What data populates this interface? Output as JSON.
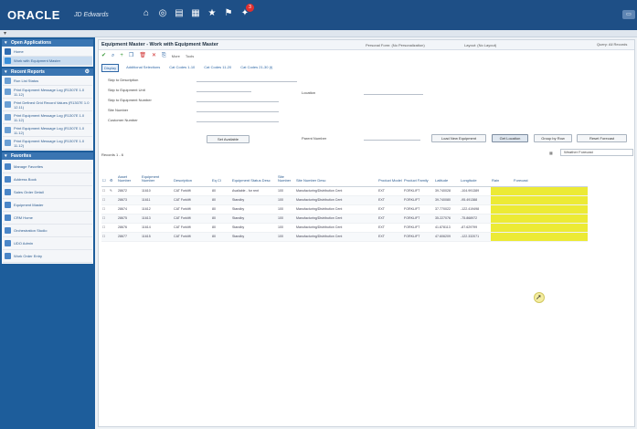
{
  "brand": {
    "logo": "ORACLE",
    "product": "JD Edwards"
  },
  "topbar": {
    "icons": [
      "home-icon",
      "globe-icon",
      "list-icon",
      "document-icon",
      "star-icon",
      "flag-icon",
      "lightbulb-icon"
    ],
    "notification_count": "3",
    "right_button": "▭",
    "colors": {
      "topbar": "#1e4f86",
      "sidebar": "#1d5d9b",
      "highlight": "#ecea35"
    }
  },
  "sidebar": {
    "sections": [
      {
        "title": "Open Applications",
        "items": [
          {
            "label": "Home",
            "icon": "home-icon",
            "color": "#2f6db3"
          },
          {
            "label": "Work with Equipment Master",
            "icon": "app-icon",
            "color": "#3a8fd8",
            "active": true
          }
        ]
      },
      {
        "title": "Recent Reports",
        "items": [
          {
            "label": "Run List Status",
            "icon": "report-icon",
            "color": "#6a9fd4"
          },
          {
            "label": "Print Equipment Message Log (R1307E 1.0 11.12)",
            "icon": "report-icon",
            "color": "#6a9fd4"
          },
          {
            "label": "Print Defined Grid Record Values (R1307E 1.0 12.11)",
            "icon": "report-icon",
            "color": "#6a9fd4"
          },
          {
            "label": "Print Equipment Message Log (R1307E 1.0 11.12)",
            "icon": "report-icon",
            "color": "#6a9fd4"
          },
          {
            "label": "Print Equipment Message Log (R1307E 1.0 11.12)",
            "icon": "report-icon",
            "color": "#6a9fd4"
          },
          {
            "label": "Print Equipment Message Log (R1307E 1.0 11.12)",
            "icon": "report-icon",
            "color": "#6a9fd4"
          }
        ]
      },
      {
        "title": "Favorites",
        "items": [
          {
            "label": "Manage Favorites",
            "icon": "gear-icon",
            "color": "#4a86c8"
          },
          {
            "label": "Address Book",
            "icon": "person-icon",
            "color": "#4a86c8"
          },
          {
            "label": "Sales Order Detail",
            "icon": "cart-icon",
            "color": "#4a86c8"
          },
          {
            "label": "Equipment Master",
            "icon": "person-icon",
            "color": "#4a86c8"
          },
          {
            "label": "CRM Home",
            "icon": "search-icon",
            "color": "#4a86c8"
          },
          {
            "label": "Orchestration Studio",
            "icon": "app-icon",
            "color": "#4a86c8"
          },
          {
            "label": "UDO Admin",
            "icon": "app-icon",
            "color": "#4a86c8"
          },
          {
            "label": "Work Order Entry",
            "icon": "search-icon",
            "color": "#4a86c8"
          }
        ]
      }
    ]
  },
  "main": {
    "title": "Equipment Master - Work with Equipment Master",
    "personal_form_label": "Personal Form: (No Personalization)",
    "layout_label": "Layout: (No Layout)",
    "query_label": "Query: All Records",
    "toolbar": {
      "icons": [
        "check-icon",
        "search-icon",
        "add-icon",
        "copy-icon",
        "delete-icon",
        "close-icon",
        "export-icon"
      ],
      "more_label": "More",
      "tools_label": "Tools"
    },
    "tabs": [
      "Display",
      "Additional Selections",
      "Cat Codes 1-10",
      "Cat Codes 11-20",
      "Cat Codes 21-30 (t)"
    ],
    "form": {
      "fields": [
        "Skip to Description",
        "Skip to Equipment Unit",
        "Skip to Equipment Number",
        "Site Number",
        "Customer Number"
      ],
      "location_label": "Location",
      "parent_label": "Parent Number"
    },
    "buttons": {
      "set_equipment": "Set Available",
      "load_new_equipment": "Load New Equipment",
      "get_location": "Get Location",
      "group_by_row": "Group by Row",
      "reset_forecast": "Reset Forecast"
    },
    "records_label": "Records 1 - 6",
    "grid_format": {
      "label": "Grid Format",
      "value": "Weather Forecast"
    },
    "grid": {
      "columns": [
        "",
        "",
        "Asset Number",
        "Equipment Number",
        "Description",
        "Eq Cl",
        "Equipment Status Desc",
        "Site Number",
        "Site Number Desc",
        "Product Model",
        "Product Family",
        "Latitude",
        "Longitude",
        "Rain",
        "Forecast"
      ],
      "rows": [
        [
          "",
          "",
          "28672",
          "11610",
          "CAT Forklift",
          "80",
          "Available - for rent",
          "100",
          "Manufacturing/Distribution Cent",
          "EXT",
          "FORKLIFT",
          "39.740028",
          "-104.991389",
          "",
          ""
        ],
        [
          "",
          "",
          "28673",
          "11611",
          "CAT Forklift",
          "80",
          "Standby",
          "100",
          "Manufacturing/Distribution Cent",
          "EXT",
          "FORKLIFT",
          "39.740080",
          "-95.491388",
          "",
          ""
        ],
        [
          "",
          "",
          "28674",
          "11612",
          "CAT Forklift",
          "80",
          "Standby",
          "100",
          "Manufacturing/Distribution Cent",
          "EXT",
          "FORKLIFT",
          "37.770022",
          "-122.419498",
          "",
          ""
        ],
        [
          "",
          "",
          "28675",
          "11613",
          "CAT Forklift",
          "80",
          "Standby",
          "100",
          "Manufacturing/Distribution Cent",
          "EXT",
          "FORKLIFT",
          "35.227076",
          "-75.868972",
          "",
          ""
        ],
        [
          "",
          "",
          "28676",
          "11614",
          "CAT Forklift",
          "80",
          "Standby",
          "100",
          "Manufacturing/Distribution Cent",
          "EXT",
          "FORKLIFT",
          "41.878113",
          "-87.629799",
          "",
          ""
        ],
        [
          "",
          "",
          "28677",
          "11615",
          "CAT Forklift",
          "80",
          "Standby",
          "100",
          "Manufacturing/Distribution Cent",
          "EXT",
          "FORKLIFT",
          "47.606209",
          "-122.332071",
          "",
          ""
        ]
      ]
    }
  }
}
